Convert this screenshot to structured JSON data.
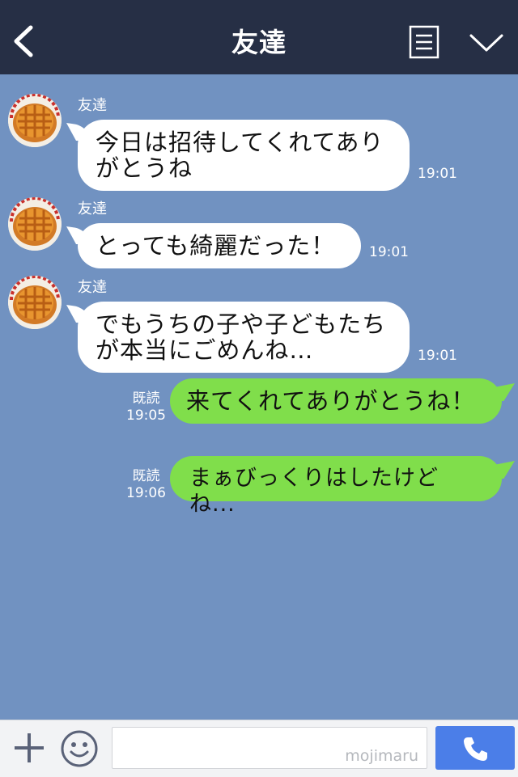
{
  "header": {
    "title": "友達"
  },
  "messages": [
    {
      "sender": "友達",
      "lines": [
        "今日は招待してくれてあり",
        "がとうね"
      ],
      "time": "19:01"
    },
    {
      "sender": "友達",
      "lines": [
        "とっても綺麗だった！"
      ],
      "time": "19:01"
    },
    {
      "sender": "友達",
      "lines": [
        "でもうちの子や子どもたち",
        "が本当にごめんね…"
      ],
      "time": "19:01"
    },
    {
      "text": "来てくれてありがとうね！",
      "read": "既読",
      "time": "19:05"
    },
    {
      "text": "まぁびっくりはしたけどね...",
      "read": "既読",
      "time": "19:06"
    }
  ],
  "input": {
    "watermark": "mojimaru"
  },
  "colors": {
    "header": "#262f45",
    "chat_bg": "#7192c1",
    "outgoing": "#80de4b",
    "call": "#4b7ee8"
  }
}
